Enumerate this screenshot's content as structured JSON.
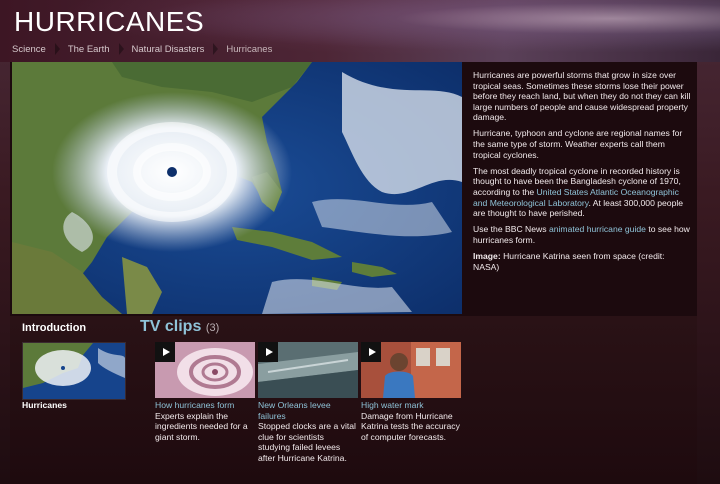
{
  "header": {
    "title": "HURRICANES",
    "breadcrumb": [
      "Science",
      "The Earth",
      "Natural Disasters",
      "Hurricanes"
    ]
  },
  "info": {
    "p1": "Hurricanes are powerful storms that grow in size over tropical seas. Sometimes these storms lose their power before they reach land, but when they do not they can kill large numbers of people and cause widespread property damage.",
    "p2": "Hurricane, typhoon and cyclone are regional names for the same type of storm. Weather experts call them tropical cyclones.",
    "p3_before": "The most deadly tropical cyclone in recorded history is thought to have been the Bangladesh cyclone of 1970, according to the ",
    "p3_link": "United States Atlantic Oceanographic and Meteorological Laboratory",
    "p3_after": ". At least 300,000 people are thought to have perished.",
    "p4_before": "Use the BBC News ",
    "p4_link": "animated hurricane guide",
    "p4_after": " to see how hurricanes form.",
    "image_label": "Image:",
    "image_caption": " Hurricane Katrina seen from space (credit: NASA)"
  },
  "intro": {
    "heading": "Introduction",
    "caption": "Hurricanes"
  },
  "tv": {
    "heading": "TV clips",
    "count": "(3)",
    "clips": [
      {
        "title": "How hurricanes form",
        "desc": "Experts explain the ingredients needed for a giant storm."
      },
      {
        "title": "New Orleans levee failures",
        "desc": "Stopped clocks are a vital clue for scientists studying failed levees after Hurricane Katrina."
      },
      {
        "title": "High water mark",
        "desc": "Damage from Hurricane Katrina tests the accuracy of computer forecasts."
      }
    ]
  },
  "colors": {
    "link": "#8fc3d8",
    "background": "#1e0a0e"
  }
}
